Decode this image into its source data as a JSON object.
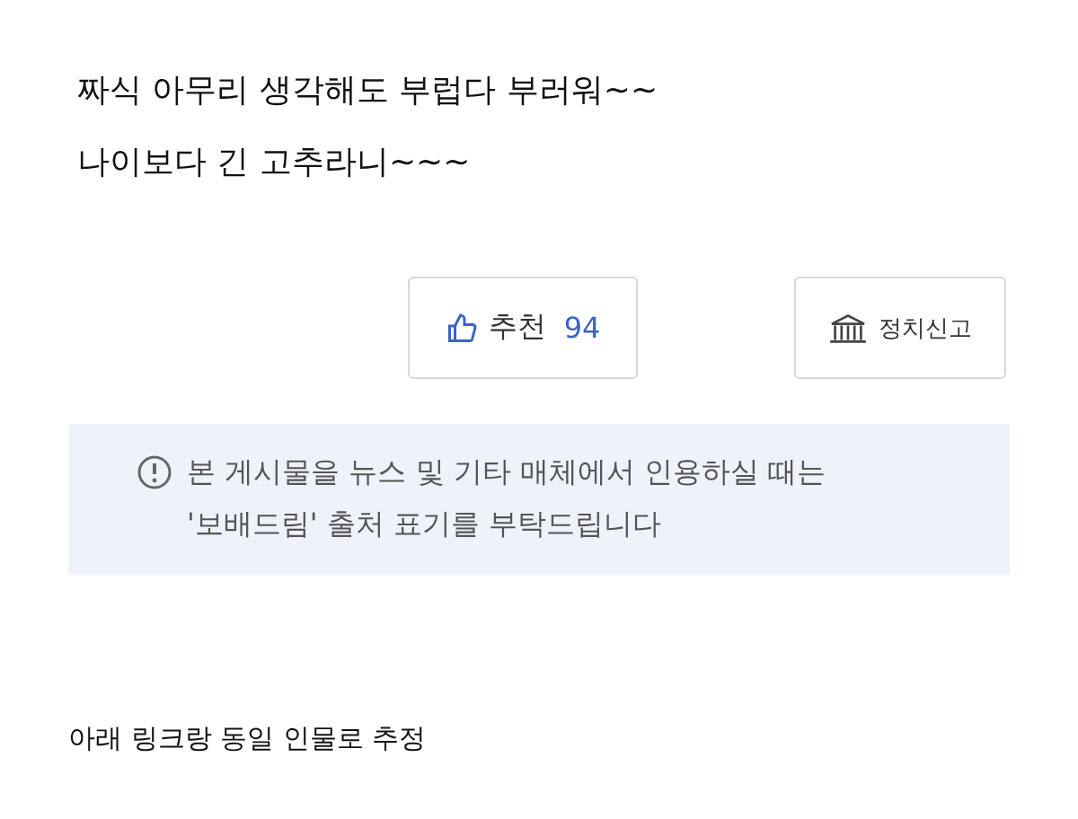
{
  "post_lines": [
    "짜식 아무리 생각해도 부럽다 부러워~~",
    "나이보다 긴 고추라니~~~"
  ],
  "recommend": {
    "label": "추천",
    "count": "94"
  },
  "report": {
    "label": "정치신고"
  },
  "notice": [
    "본 게시물을 뉴스 및 기타 매체에서 인용하실 때는",
    "'보배드림' 출처 표기를 부탁드립니다"
  ],
  "footer_text": "아래 링크랑 동일 인물로 추정"
}
